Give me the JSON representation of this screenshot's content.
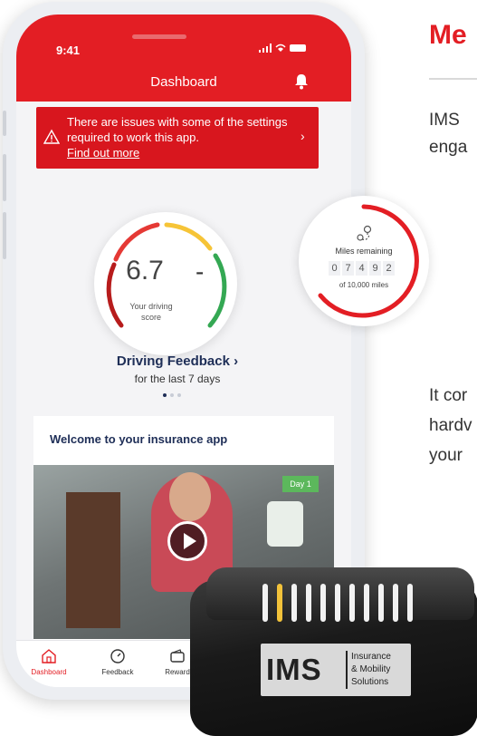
{
  "page": {
    "heading": "Me",
    "text_lines_top": [
      "IMS",
      "enga"
    ],
    "text_lines_bottom": [
      "It cor",
      "hardv",
      "your"
    ],
    "accent_color": "#e31e24"
  },
  "phone": {
    "status": {
      "time": "9:41",
      "signal_icon": "signal-icon",
      "wifi_icon": "wifi-icon",
      "battery_icon": "battery-icon"
    },
    "header": {
      "title": "Dashboard",
      "bell_icon": "bell-icon"
    },
    "alert": {
      "message": "There are issues with some of the settings required to work this app.",
      "link": "Find out more",
      "icon": "warning-icon",
      "chevron": "›"
    },
    "score": {
      "value": "6.7",
      "trend": "-",
      "label_line1": "Your driving",
      "label_line2": "score"
    },
    "feedback": {
      "title": "Driving Feedback ›",
      "subtitle": "for the last 7 days"
    },
    "carousel": {
      "pages": 3,
      "active": 0
    },
    "welcome": {
      "title": "Welcome to your insurance app",
      "badge": "Day 1"
    },
    "nav": [
      {
        "label": "Dashboard",
        "icon": "home-icon",
        "active": true
      },
      {
        "label": "Feedback",
        "icon": "gauge-icon",
        "active": false
      },
      {
        "label": "Reward",
        "icon": "wallet-icon",
        "active": false
      }
    ]
  },
  "miles": {
    "label": "Miles remaining",
    "digits": [
      "0",
      "7",
      "4",
      "9",
      "2"
    ],
    "of_text": "of 10,000 miles",
    "icon": "route-icon"
  },
  "device": {
    "brand": "IMS",
    "tagline_line1": "Insurance",
    "tagline_line2": "& Mobility",
    "tagline_line3": "Solutions"
  }
}
